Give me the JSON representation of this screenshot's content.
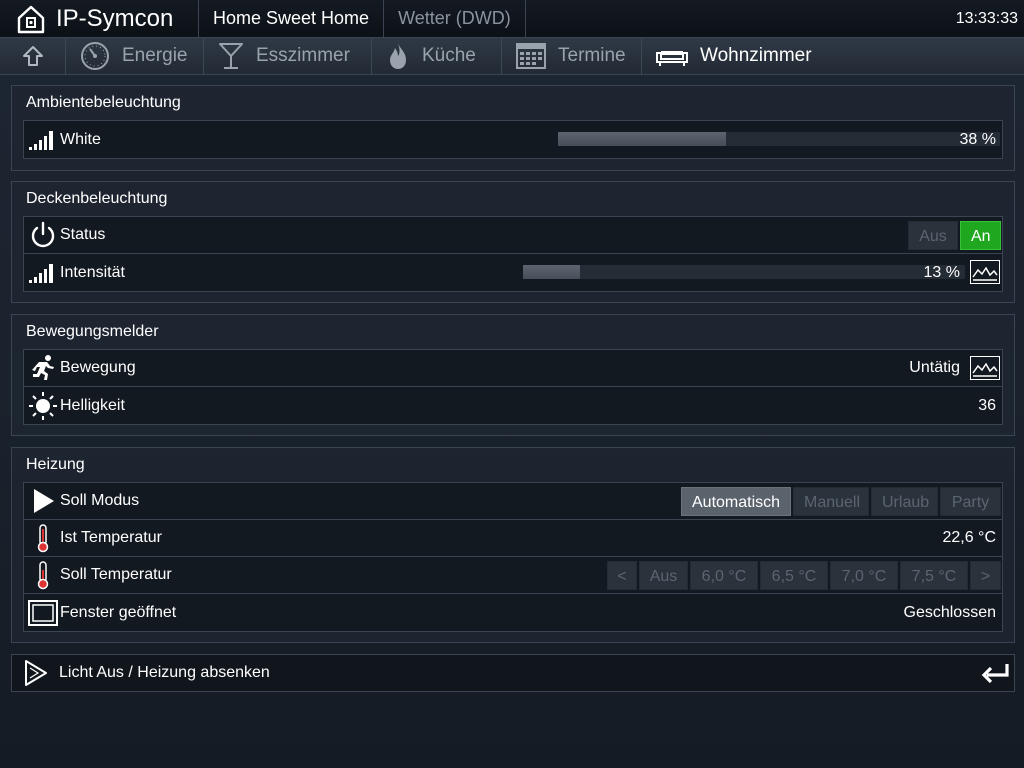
{
  "app": {
    "title": "IP-Symcon",
    "time": "13:33:33"
  },
  "top_tabs": [
    {
      "label": "Home Sweet Home",
      "active": true
    },
    {
      "label": "Wetter (DWD)",
      "active": false
    }
  ],
  "nav": {
    "items": [
      {
        "label": "Energie",
        "icon": "gauge-icon"
      },
      {
        "label": "Esszimmer",
        "icon": "cocktail-glass-icon"
      },
      {
        "label": "Küche",
        "icon": "flame-icon"
      },
      {
        "label": "Termine",
        "icon": "calendar-icon"
      },
      {
        "label": "Wohnzimmer",
        "icon": "sofa-icon",
        "active": true
      }
    ]
  },
  "panels": {
    "ambient": {
      "title": "Ambientebeleuchtung",
      "white": {
        "label": "White",
        "value": "38 %",
        "level": 0.38
      }
    },
    "ceiling": {
      "title": "Deckenbeleuchtung",
      "status": {
        "label": "Status",
        "off_label": "Aus",
        "on_label": "An",
        "state": "on"
      },
      "intensity": {
        "label": "Intensität",
        "value": "13 %",
        "level": 0.13
      }
    },
    "motion": {
      "title": "Bewegungsmelder",
      "movement": {
        "label": "Bewegung",
        "value": "Untätig"
      },
      "brightness": {
        "label": "Helligkeit",
        "value": "36"
      }
    },
    "heating": {
      "title": "Heizung",
      "mode": {
        "label": "Soll Modus",
        "options": [
          "Automatisch",
          "Manuell",
          "Urlaub",
          "Party"
        ],
        "selected": "Automatisch"
      },
      "actual_temp": {
        "label": "Ist Temperatur",
        "value": "22,6 °C"
      },
      "target_temp": {
        "label": "Soll Temperatur",
        "prev": "<",
        "options": [
          "Aus",
          "6,0 °C",
          "6,5 °C",
          "7,0 °C",
          "7,5 °C"
        ],
        "next": ">"
      },
      "window": {
        "label": "Fenster geöffnet",
        "value": "Geschlossen"
      }
    }
  },
  "action": {
    "label": "Licht Aus / Heizung absenken"
  },
  "colors": {
    "accent_on": "#1fa81f",
    "background": "#1a222d"
  }
}
